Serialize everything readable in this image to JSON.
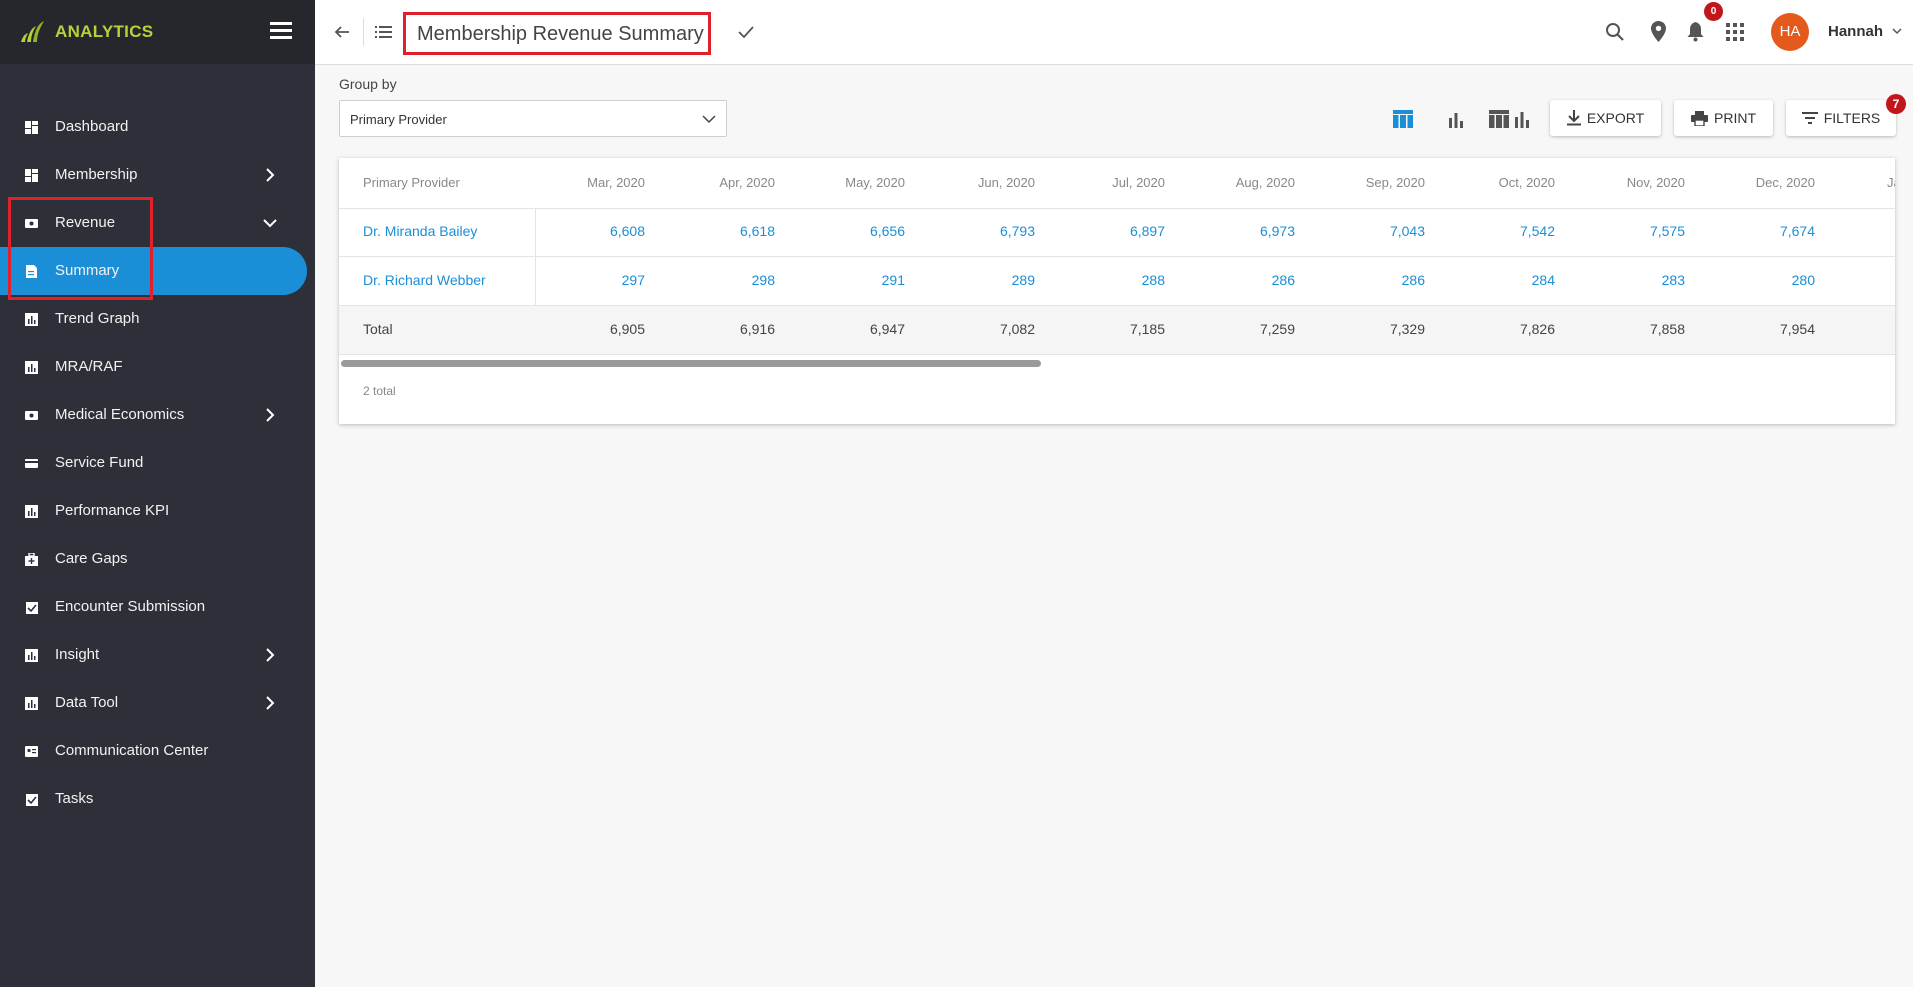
{
  "brand": {
    "name": "ANALYTICS"
  },
  "sidebar": {
    "items": [
      {
        "label": "Dashboard"
      },
      {
        "label": "Membership"
      },
      {
        "label": "Revenue"
      },
      {
        "label": "Summary"
      },
      {
        "label": "Trend Graph"
      },
      {
        "label": "MRA/RAF"
      },
      {
        "label": "Medical Economics"
      },
      {
        "label": "Service Fund"
      },
      {
        "label": "Performance KPI"
      },
      {
        "label": "Care Gaps"
      },
      {
        "label": "Encounter Submission"
      },
      {
        "label": "Insight"
      },
      {
        "label": "Data Tool"
      },
      {
        "label": "Communication Center"
      },
      {
        "label": "Tasks"
      }
    ]
  },
  "header": {
    "title": "Membership Revenue Summary",
    "notifications_count": "0",
    "avatar_initials": "HA",
    "user_name": "Hannah"
  },
  "controls": {
    "group_by_label": "Group by",
    "group_by_value": "Primary Provider",
    "export_label": "EXPORT",
    "print_label": "PRINT",
    "filters_label": "FILTERS",
    "filters_count": "7"
  },
  "table": {
    "columns": [
      "Primary Provider",
      "Mar, 2020",
      "Apr, 2020",
      "May, 2020",
      "Jun, 2020",
      "Jul, 2020",
      "Aug, 2020",
      "Sep, 2020",
      "Oct, 2020",
      "Nov, 2020",
      "Dec, 2020",
      "Ja"
    ],
    "rows": [
      {
        "provider": "Dr. Miranda Bailey",
        "values": [
          "6,608",
          "6,618",
          "6,656",
          "6,793",
          "6,897",
          "6,973",
          "7,043",
          "7,542",
          "7,575",
          "7,674"
        ]
      },
      {
        "provider": "Dr. Richard Webber",
        "values": [
          "297",
          "298",
          "291",
          "289",
          "288",
          "286",
          "286",
          "284",
          "283",
          "280"
        ]
      }
    ],
    "total": {
      "label": "Total",
      "values": [
        "6,905",
        "6,916",
        "6,947",
        "7,082",
        "7,185",
        "7,259",
        "7,329",
        "7,826",
        "7,858",
        "7,954"
      ]
    },
    "footer": "2 total"
  },
  "colors": {
    "sidebar_bg": "#2d3038",
    "accent": "#1a8fd8",
    "brand_green": "#b6d23a",
    "badge_red": "#c0161c",
    "highlight_red": "#e0202a",
    "avatar": "#e45a1c"
  }
}
